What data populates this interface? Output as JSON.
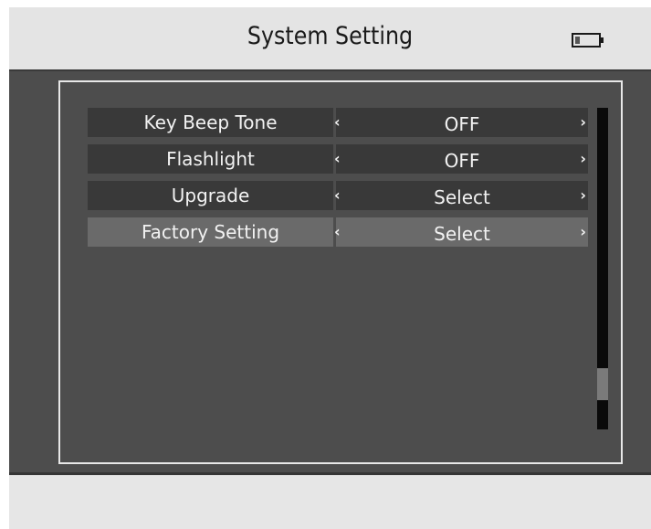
{
  "header": {
    "title": "System Setting",
    "battery_icon": "battery-low-icon",
    "battery_level": 0.2
  },
  "menu": {
    "items": [
      {
        "label": "Key Beep Tone",
        "value": "OFF",
        "selected": false
      },
      {
        "label": "Flashlight",
        "value": "OFF",
        "selected": false
      },
      {
        "label": "Upgrade",
        "value": "Select",
        "selected": false
      },
      {
        "label": "Factory Setting",
        "value": "Select",
        "selected": true
      }
    ],
    "left_arrow": "‹",
    "right_arrow": "›"
  },
  "scrollbar": {
    "position": 0.9,
    "thumb_fraction": 0.1
  },
  "colors": {
    "panel_background": "#4d4d4d",
    "row_background": "#393939",
    "row_selected": "#6a6a6a",
    "header_background": "#e4e4e4",
    "text": "#f2f2f2"
  }
}
